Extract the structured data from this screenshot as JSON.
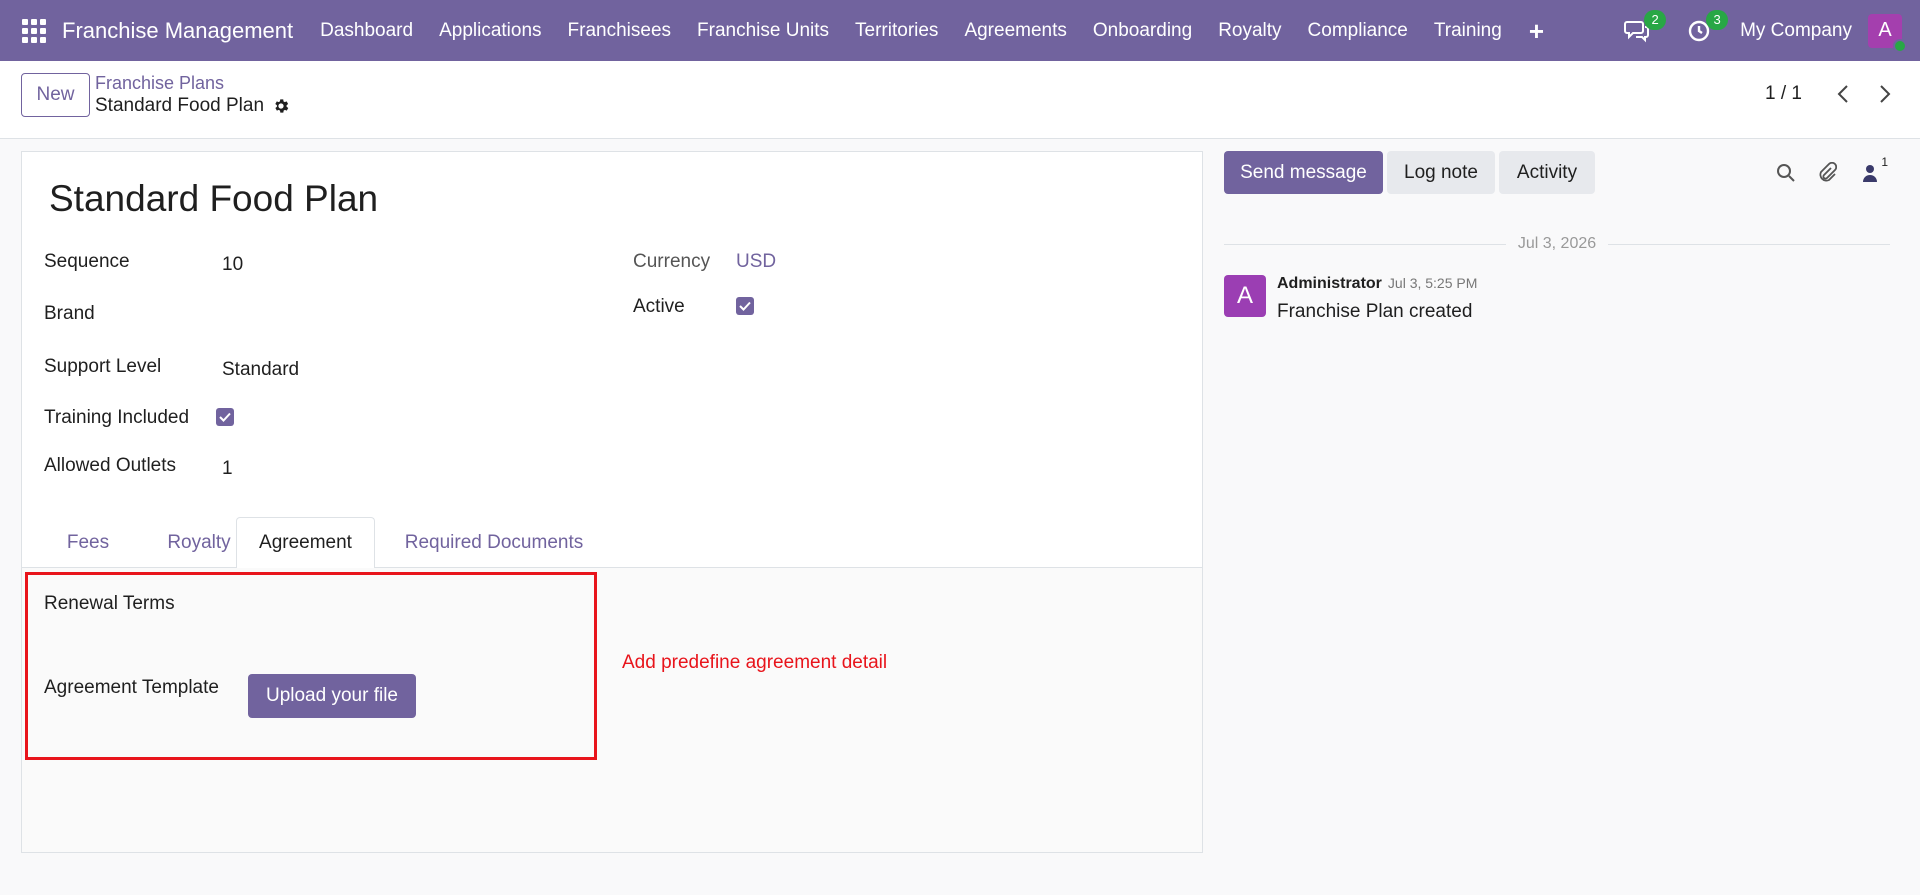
{
  "navbar": {
    "brand": "Franchise Management",
    "menu": [
      "Dashboard",
      "Applications",
      "Franchisees",
      "Franchise Units",
      "Territories",
      "Agreements",
      "Onboarding",
      "Royalty",
      "Compliance",
      "Training"
    ],
    "messages_badge": "2",
    "activities_badge": "3",
    "company": "My Company",
    "avatar_initial": "A",
    "accent_color": "#71639e"
  },
  "control_panel": {
    "new_label": "New",
    "breadcrumb_parent": "Franchise Plans",
    "record_name": "Standard Food Plan",
    "pager": "1 / 1"
  },
  "form": {
    "title": "Standard Food Plan",
    "left_fields": {
      "sequence_label": "Sequence",
      "sequence_value": "10",
      "brand_label": "Brand",
      "support_level_label": "Support Level",
      "support_level_value": "Standard",
      "training_included_label": "Training Included",
      "training_included_checked": true,
      "allowed_outlets_label": "Allowed Outlets",
      "allowed_outlets_value": "1"
    },
    "right_fields": {
      "currency_label": "Currency",
      "currency_value": "USD",
      "active_label": "Active",
      "active_checked": true
    },
    "tabs": [
      "Fees",
      "Royalty",
      "Agreement",
      "Required Documents"
    ],
    "active_tab": "Agreement",
    "agreement": {
      "renewal_terms_label": "Renewal Terms",
      "agreement_template_label": "Agreement Template",
      "upload_label": "Upload your file"
    },
    "annotation": "Add predefine agreement detail",
    "annotation_color": "#e8141b"
  },
  "chatter": {
    "send_message": "Send message",
    "log_note": "Log note",
    "activity": "Activity",
    "follower_count": "1",
    "date": "Jul 3, 2026",
    "message": {
      "avatar_initial": "A",
      "author": "Administrator",
      "time": "Jul 3, 5:25 PM",
      "body": "Franchise Plan created"
    }
  }
}
